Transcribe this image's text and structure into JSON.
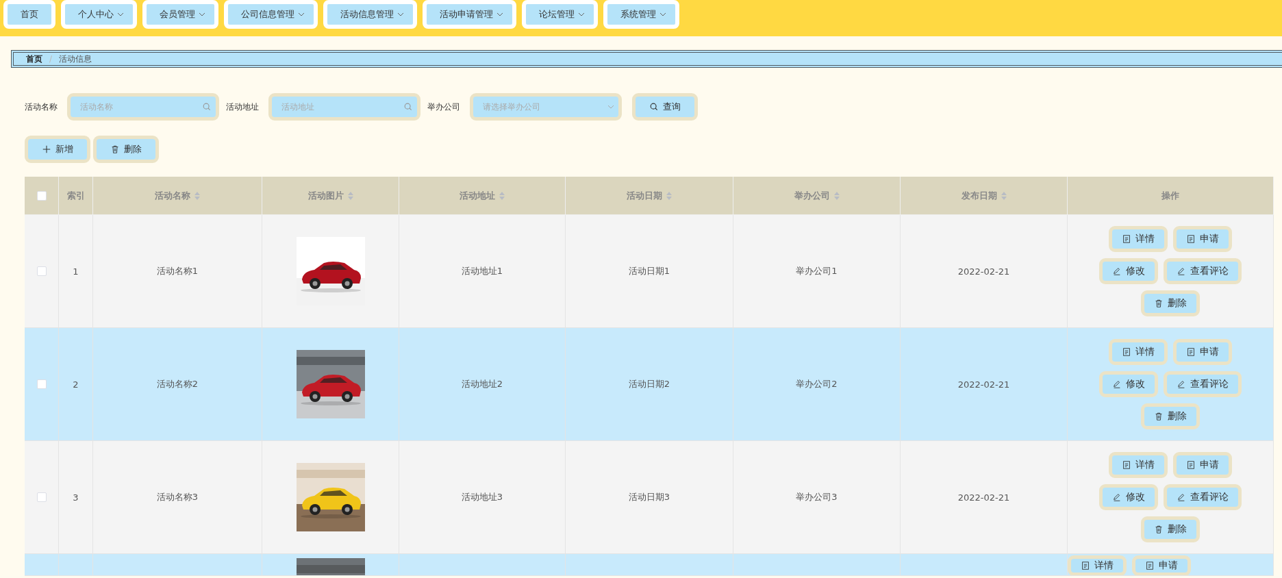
{
  "nav": [
    {
      "label": "首页",
      "dropdown": false
    },
    {
      "label": "个人中心",
      "dropdown": true
    },
    {
      "label": "会员管理",
      "dropdown": true
    },
    {
      "label": "公司信息管理",
      "dropdown": true
    },
    {
      "label": "活动信息管理",
      "dropdown": true
    },
    {
      "label": "活动申请管理",
      "dropdown": true
    },
    {
      "label": "论坛管理",
      "dropdown": true
    },
    {
      "label": "系统管理",
      "dropdown": true
    }
  ],
  "breadcrumb": [
    {
      "label": "首页",
      "current": false
    },
    {
      "label": "/",
      "kind": "separator"
    },
    {
      "label": "活动信息",
      "current": true
    }
  ],
  "filters": [
    {
      "label": "活动名称",
      "placeholder": "活动名称",
      "kind": "search"
    },
    {
      "label": "活动地址",
      "placeholder": "活动地址",
      "kind": "search"
    },
    {
      "label": "举办公司",
      "placeholder": "请选择举办公司",
      "kind": "select"
    }
  ],
  "query_button": {
    "label": "查询",
    "kind": "search"
  },
  "actions": [
    {
      "label": "新增",
      "kind": "add"
    },
    {
      "label": "删除",
      "kind": "delete"
    }
  ],
  "table": {
    "select_all": {
      "checked": false
    },
    "columns": [
      {
        "label": "索引",
        "sortable": false
      },
      {
        "label": "活动名称",
        "sortable": true
      },
      {
        "label": "活动图片",
        "sortable": true
      },
      {
        "label": "活动地址",
        "sortable": true
      },
      {
        "label": "活动日期",
        "sortable": true
      },
      {
        "label": "举办公司",
        "sortable": true
      },
      {
        "label": "发布日期",
        "sortable": true
      },
      {
        "label": "操作",
        "sortable": false
      }
    ],
    "rows": [
      {
        "partial": false,
        "checked": false,
        "cells": [
          "1",
          "活动名称1",
          {
            "kind": "picture"
          },
          "活动地址1",
          "活动日期1",
          "举办公司1",
          "2022-02-21"
        ],
        "actions": [
          {
            "label": "详情",
            "kind": "detail"
          },
          {
            "label": "申请",
            "kind": "apply"
          },
          {
            "label": "修改",
            "kind": "edit"
          },
          {
            "label": "查看评论",
            "kind": "comments"
          },
          {
            "label": "删除",
            "kind": "delete"
          }
        ]
      },
      {
        "partial": false,
        "checked": false,
        "cells": [
          "2",
          "活动名称2",
          {
            "kind": "picture"
          },
          "活动地址2",
          "活动日期2",
          "举办公司2",
          "2022-02-21"
        ],
        "actions": [
          {
            "label": "详情",
            "kind": "detail"
          },
          {
            "label": "申请",
            "kind": "apply"
          },
          {
            "label": "修改",
            "kind": "edit"
          },
          {
            "label": "查看评论",
            "kind": "comments"
          },
          {
            "label": "删除",
            "kind": "delete"
          }
        ]
      },
      {
        "partial": false,
        "checked": false,
        "cells": [
          "3",
          "活动名称3",
          {
            "kind": "picture"
          },
          "活动地址3",
          "活动日期3",
          "举办公司3",
          "2022-02-21"
        ],
        "actions": [
          {
            "label": "详情",
            "kind": "detail"
          },
          {
            "label": "申请",
            "kind": "apply"
          },
          {
            "label": "修改",
            "kind": "edit"
          },
          {
            "label": "查看评论",
            "kind": "comments"
          },
          {
            "label": "删除",
            "kind": "delete"
          }
        ]
      },
      {
        "partial": true,
        "cells": [
          "",
          "",
          {
            "kind": "picture"
          },
          "",
          "",
          "",
          ""
        ],
        "actions": [
          {
            "label": "详情",
            "kind": "detail"
          },
          {
            "label": "申请",
            "kind": "apply"
          }
        ]
      }
    ]
  }
}
